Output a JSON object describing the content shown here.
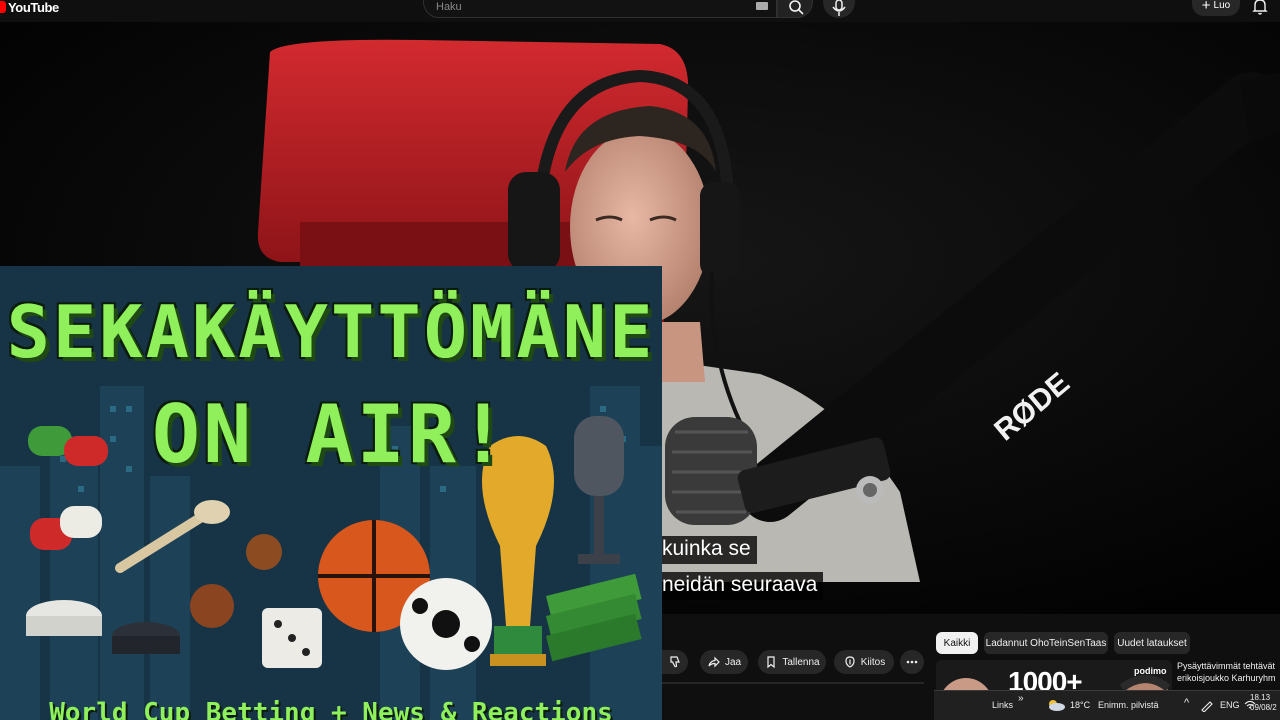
{
  "header": {
    "logo_text": "YouTube",
    "search_placeholder": "Haku",
    "create_label": "Luo",
    "icons": [
      "keyboard-icon",
      "search-icon",
      "microphone-icon",
      "plus-icon",
      "bell-icon"
    ]
  },
  "video": {
    "subtitles": [
      "kuinka se",
      "neidän seuraava"
    ],
    "mic_brand": "RØDE",
    "overlay": {
      "title_line1": "SEKAKÄYTTÖMÄNE",
      "title_line2": "ON AIR!",
      "subtitle": "World Cup Betting + News & Reactions"
    }
  },
  "actions": {
    "buttons": [
      {
        "name": "dislike",
        "label": "",
        "icon": "thumbs-down-icon"
      },
      {
        "name": "share",
        "label": "Jaa",
        "icon": "share-icon"
      },
      {
        "name": "save",
        "label": "Tallenna",
        "icon": "bookmark-icon"
      },
      {
        "name": "thanks",
        "label": "Kiitos",
        "icon": "thanks-icon"
      },
      {
        "name": "more",
        "label": "",
        "icon": "more-icon"
      }
    ]
  },
  "related": {
    "chips": [
      {
        "label": "Kaikki",
        "active": true
      },
      {
        "label": "Ladannut OhoTeinSenTaas",
        "active": false
      },
      {
        "label": "Uudet lataukset",
        "active": false
      }
    ],
    "card": {
      "thumb_text": "1000+",
      "thumb_brand": "podimo",
      "title_line1": "Pysäyttävimmät tehtävät",
      "title_line2": "erikoisjoukko Karhuryhm"
    }
  },
  "taskbar": {
    "links": "Links",
    "weather": "18°C",
    "weather_desc": "Enimm. pilvistä",
    "lang": "ENG",
    "time": "18.13",
    "date": "09/08/2"
  },
  "colors": {
    "youtube_red": "#ff0000",
    "pixel_green": "#8ff05c",
    "chair_red": "#c21f25"
  }
}
